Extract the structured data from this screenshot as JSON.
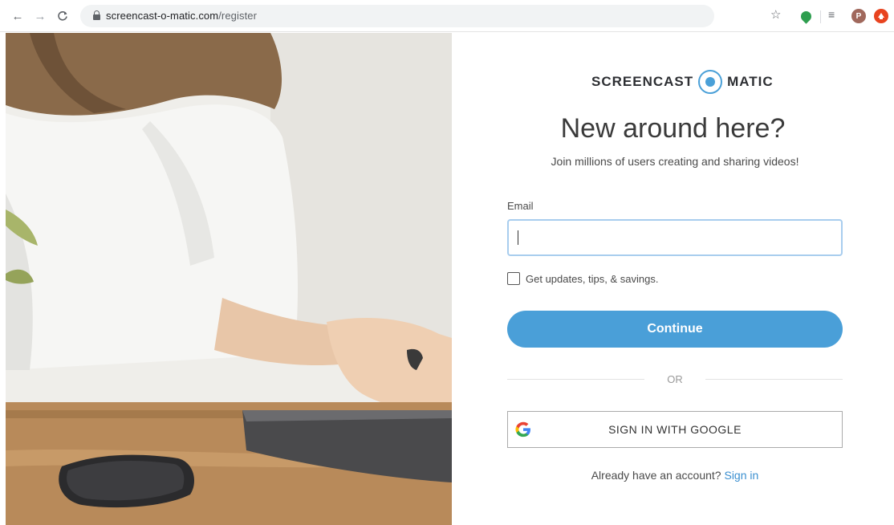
{
  "browser": {
    "url_domain": "screencast-o-matic.com",
    "url_path": "/register",
    "profile_initial": "P"
  },
  "logo": {
    "word_left": "SCREENCAST",
    "word_right": "MATIC"
  },
  "form": {
    "title": "New around here?",
    "subtitle": "Join millions of users creating and sharing videos!",
    "email_label": "Email",
    "email_value": "",
    "checkbox_label": "Get updates, tips, & savings.",
    "checkbox_checked": false,
    "continue_label": "Continue",
    "or_text": "OR",
    "google_label": "SIGN IN WITH GOOGLE",
    "signin_prompt": "Already have an account? ",
    "signin_link": "Sign in"
  },
  "colors": {
    "accent": "#4a9fd8",
    "link": "#3a8fd0",
    "input_focus_border": "#a8cdee"
  }
}
